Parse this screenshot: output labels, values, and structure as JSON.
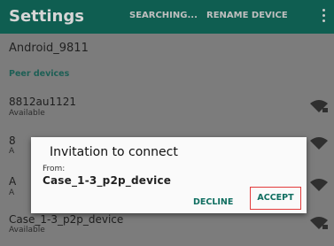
{
  "appbar": {
    "title": "Settings",
    "action_search": "SEARCHING...",
    "action_rename": "RENAME DEVICE",
    "overflow_icon": "more-vert-icon"
  },
  "device": {
    "name": "Android_9811"
  },
  "peers": {
    "header": "Peer devices",
    "items": [
      {
        "name": "8812au1121",
        "status": "Available",
        "icon": "wifi-locked-icon"
      },
      {
        "name": "8",
        "status": "A",
        "icon": "wifi-locked-icon"
      },
      {
        "name": "A",
        "status": "A",
        "icon": "wifi-locked-icon"
      },
      {
        "name": "Case_1-3_p2p_device",
        "status": "Available",
        "icon": "wifi-locked-icon"
      }
    ]
  },
  "dialog": {
    "title": "Invitation to connect",
    "from_label": "From:",
    "from_device": "Case_1-3_p2p_device",
    "decline": "DECLINE",
    "accept": "ACCEPT"
  },
  "colors": {
    "appbar": "#0f5e51",
    "accent": "#0f6e60",
    "highlight": "#e23b3b"
  }
}
